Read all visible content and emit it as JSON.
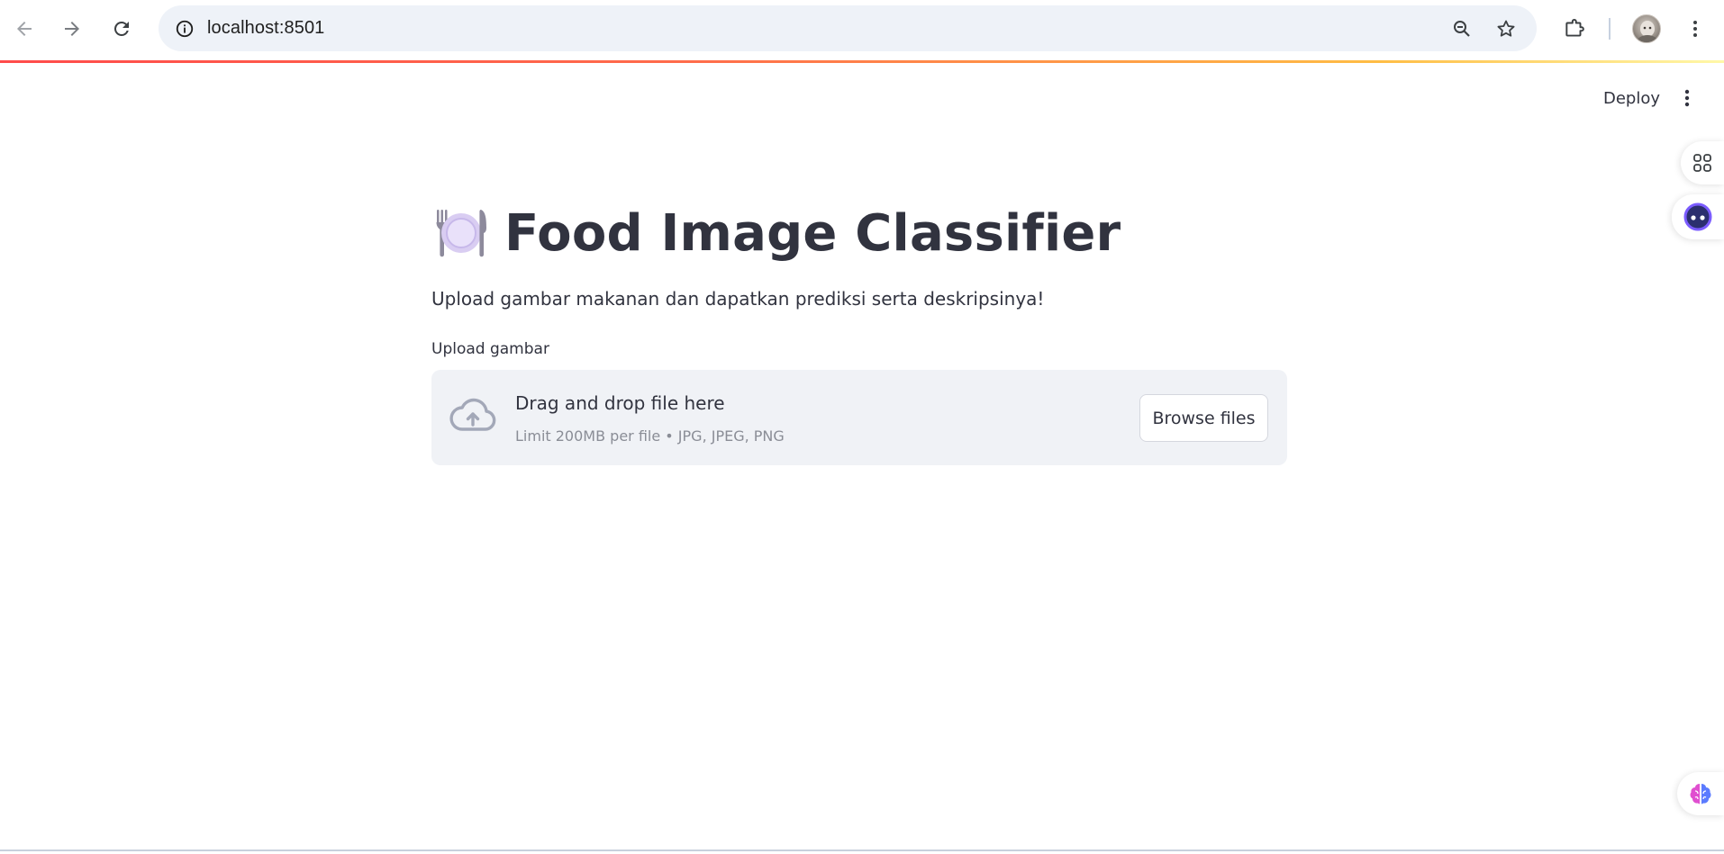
{
  "browser": {
    "url": "localhost:8501",
    "icons": {
      "back": "arrow-left-icon",
      "forward": "arrow-right-icon",
      "reload": "reload-icon",
      "site_info": "info-icon",
      "zoom": "zoom-out-icon",
      "bookmark": "star-icon",
      "extensions": "puzzle-icon",
      "menu": "more-vert-icon"
    }
  },
  "app_header": {
    "deploy_label": "Deploy",
    "menu_icon": "more-vert-icon"
  },
  "side_widgets": [
    "apps-grid-icon",
    "assistant-face-icon",
    "brain-icon"
  ],
  "main": {
    "title_emoji": "🍽️",
    "title": "Food Image Classifier",
    "subtitle": "Upload gambar makanan dan dapatkan prediksi serta deskripsinya!",
    "uploader": {
      "label": "Upload gambar",
      "drop_title": "Drag and drop file here",
      "limit_text": "Limit 200MB per file • JPG, JPEG, PNG",
      "browse_label": "Browse files",
      "icon": "cloud-upload-icon"
    }
  },
  "colors": {
    "text": "#31333f",
    "muted": "#8a8d96",
    "dropzone_bg": "#f0f2f6",
    "omnibox_bg": "#eef2f8",
    "accent_start": "#ff4b4b",
    "accent_end": "#fff8a8"
  }
}
